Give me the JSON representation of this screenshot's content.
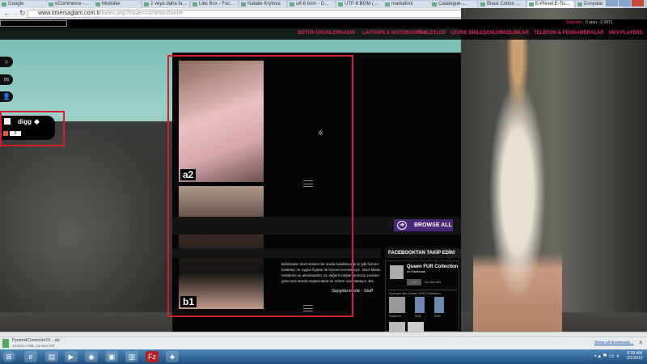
{
  "browser": {
    "tabs": [
      "Google",
      "eCommerce -...",
      "Modüller",
      "2 veya daha fa...",
      "Like Box - Fac...",
      "Natalie Krytova",
      "utf-8 bom - G...",
      "UTF-8 BOM (...",
      "markafoni",
      "Catalogue-...",
      "Black Cotton ...",
      "E-Piksel E-Tic...",
      "Dosyalar : Pyl..."
    ],
    "active_tab": 11,
    "url_domain": "www.omersaglam.com.tr",
    "url_path": "/index.php?route=common/home"
  },
  "site": {
    "cart_label": "Sepetim :",
    "cart_value": "0 ürün - 0,00TL",
    "nav": [
      "BÜTÜN ÜRÜNLER",
      "KADIN",
      "LAPTOPS & NOTEBOOKS",
      "TABLETLER",
      "ÇEVRE BİRLEŞENLER",
      "YAZILIMLAR",
      "TELEFON & PDA",
      "KAMERALAR",
      "MP3 PLAYERS"
    ],
    "side_icons": [
      "search-icon",
      "mail-icon",
      "user-icon"
    ],
    "social": {
      "digg": "digg",
      "count": "0"
    },
    "products": [
      {
        "label": "a2"
      },
      {
        "label": "b1"
      }
    ],
    "browse_all": "BROWSE ALL",
    "about_text": "Birbirinden özel ürünleri bir arada bulabileceğiniz gibi hizmet kalitemiz ve uygun fiyatlar ile hizmet vermekteyiz. 2012 Moda ürünlerini ve aksesuarları siz değerli müşterilerimizin zevkine göre özel olarak araştırmakta ve sizlere sunmaktayız. Biz",
    "signature": "Saygılarımızla - Staff",
    "facebook": {
      "header": "FACEBOOKTAN TAKİP EDİN!",
      "page": "Queen FUR Collection",
      "on": "on Facebook",
      "like": "Like",
      "like_text": "You like this.",
      "people": "4 people like Queen FUR Collection.",
      "fans": [
        "Shakeera",
        "ŞEM",
        "ŞEM"
      ]
    }
  },
  "downloads": {
    "file": "PyramidConnector10....zip",
    "status": "14.5/31.0 MB, 23 secs left",
    "show_all": "Show all downloads..."
  },
  "taskbar": {
    "time": "8:28 AM",
    "date": "2/1/2012"
  }
}
